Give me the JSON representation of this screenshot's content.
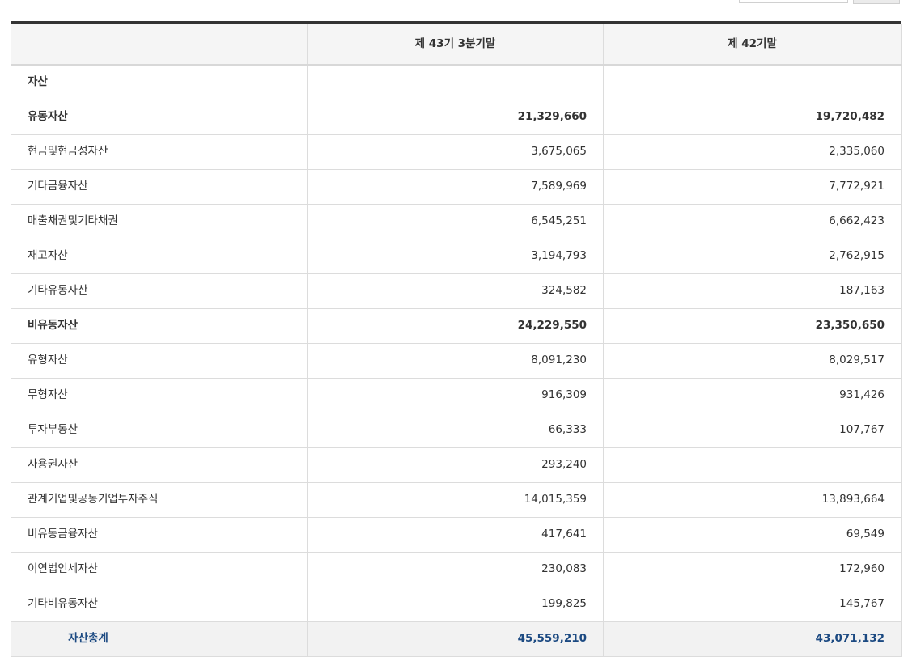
{
  "table": {
    "headers": [
      "",
      "제 43기 3분기말",
      "제 42기말"
    ],
    "rows": [
      {
        "label": "자산",
        "current": "",
        "prior": "",
        "style": "bold"
      },
      {
        "label": "유동자산",
        "current": "21,329,660",
        "prior": "19,720,482",
        "style": "bold"
      },
      {
        "label": "현금및현금성자산",
        "current": "3,675,065",
        "prior": "2,335,060",
        "style": "normal"
      },
      {
        "label": "기타금융자산",
        "current": "7,589,969",
        "prior": "7,772,921",
        "style": "normal"
      },
      {
        "label": "매출채권및기타채권",
        "current": "6,545,251",
        "prior": "6,662,423",
        "style": "normal"
      },
      {
        "label": "재고자산",
        "current": "3,194,793",
        "prior": "2,762,915",
        "style": "normal"
      },
      {
        "label": "기타유동자산",
        "current": "324,582",
        "prior": "187,163",
        "style": "normal"
      },
      {
        "label": "비유동자산",
        "current": "24,229,550",
        "prior": "23,350,650",
        "style": "bold"
      },
      {
        "label": "유형자산",
        "current": "8,091,230",
        "prior": "8,029,517",
        "style": "normal"
      },
      {
        "label": "무형자산",
        "current": "916,309",
        "prior": "931,426",
        "style": "normal"
      },
      {
        "label": "투자부동산",
        "current": "66,333",
        "prior": "107,767",
        "style": "normal"
      },
      {
        "label": "사용권자산",
        "current": "293,240",
        "prior": "",
        "style": "normal"
      },
      {
        "label": "관계기업및공동기업투자주식",
        "current": "14,015,359",
        "prior": "13,893,664",
        "style": "normal"
      },
      {
        "label": "비유동금융자산",
        "current": "417,641",
        "prior": "69,549",
        "style": "normal"
      },
      {
        "label": "이연법인세자산",
        "current": "230,083",
        "prior": "172,960",
        "style": "normal"
      },
      {
        "label": "기타비유동자산",
        "current": "199,825",
        "prior": "145,767",
        "style": "normal"
      },
      {
        "label": "자산총계",
        "current": "45,559,210",
        "prior": "43,071,132",
        "style": "total"
      }
    ]
  }
}
